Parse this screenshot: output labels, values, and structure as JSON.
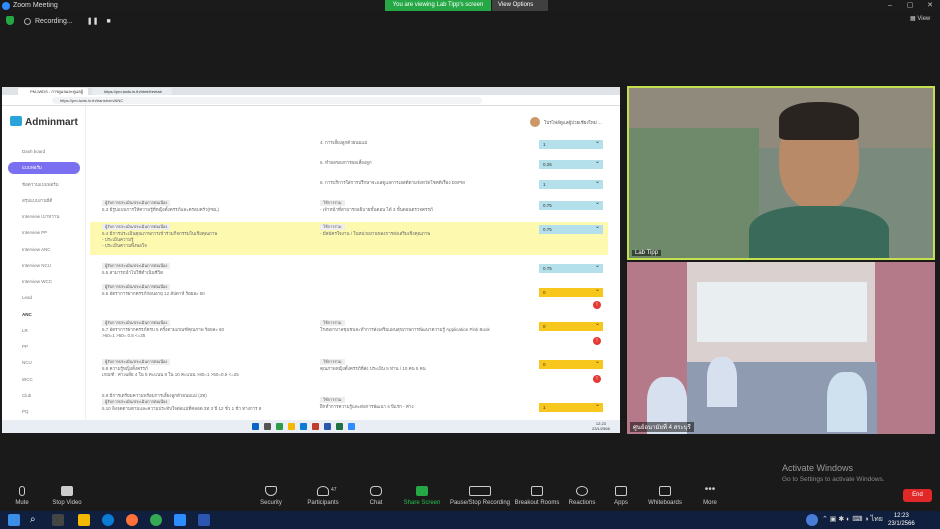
{
  "app": {
    "title": "Zoom Meeting",
    "share_banner": "You are viewing Lab Tipp's screen",
    "view_options": "View Options",
    "recording": "Recording...",
    "view": "View"
  },
  "browser": {
    "tab1": "PM-IWDS - การดูแลและดูแลผู้ป่วย",
    "tab2": "https://pm-iwds.in.th/html/freetab",
    "url": "https://pm-iwds.in.th/transform/ANC"
  },
  "app_page": {
    "logo": "Adminmart",
    "user": "โปรไฟล์ดูแลผู้ป่วยเชียงใหม่ ...",
    "nav": [
      "Dash board",
      "แบบฟอร์ม",
      "ข้อความแบบฟอร์ม",
      "สรุปแบบงานมีดี",
      "Interview เบาหวาน",
      "Interview PP",
      "Interview ANC",
      "Interview NCU",
      "Interview WCC",
      "Lead",
      "ANC",
      "LR",
      "PP",
      "NCU",
      "WCC",
      "Club",
      "PQ"
    ],
    "rows": [
      {
        "q": "4. การเลี้ยงลูกด้วยนมแม่",
        "val": "1"
      },
      {
        "q": "5. ทำผลของการผลเลี้ยงลูก",
        "val": "0.25"
      },
      {
        "q": "6. การบริการใส่การปรึกษาจะแลดูแลการเอสดีตามจังหวัดโชคดีเรื่อง DSPM",
        "val": "1"
      },
      {
        "tag": "ผู้รับการประเมิน/ประเมินการต่อเนื่อง",
        "q": "5.3 มีรูปแบบการให้ความรู้ที่หญิงตั้งครรภ์และครอบครัว(PBL)",
        "tag2": "ใช้การร่วม",
        "note": "- เจ้าหน้าที่สามารถอธิบายขั้นตอน ได้ 3 ขั้นตอนตรวจครรภ์",
        "val": "0.75"
      },
      {
        "tag": "ผู้รับการประเมิน/ประเมินการต่อเนื่อง",
        "q": "5.4 มีการประเมินคุณภาพการเข้าร่วมกิจกรรมในเชิงคุณภาพ",
        "sub1": "- ประเมินความรู้",
        "sub2": "- ประเมินความพึงพอใจ",
        "tag2": "ใช้การร่วม",
        "note": "- มีสมัครใจงาน / ในหน่วยงานของการส่งเสริมเชิงคุณภาพ",
        "val": "0.75"
      },
      {
        "tag": "ผู้รับการประเมิน/ประเมินการต่อเนื่อง",
        "q": "5.5 สามารถนำไปใช้ดำเนินชีวิต",
        "val": "0.75"
      },
      {
        "tag": "ผู้รับการประเมิน/ประเมินการต่อเนื่อง",
        "q": "5.6 อัตราการฝากครรภ์ก่อนอายุ 12 สัปดาห์ ร้อยละ 50",
        "val": "0"
      },
      {
        "tag": "ผู้รับการประเมิน/ประเมินการต่อเนื่อง",
        "q": "5.7 อัตราการฝากครรภ์ครบ 5 ครั้งตามเกณฑ์คุณภาพ ร้อยละ 60",
        "sub1": ">60=1 >50= 0.5 <=25",
        "tag2": "ใช้การร่วม",
        "note": "โรงพยาบาลชุมชนจะทำการส่งเสริมแผนสุขภาพการพัฒนาความรู้ Application Pink Book",
        "val": "0"
      },
      {
        "tag": "ผู้รับการประเมิน/ประเมินการต่อเนื่อง",
        "q": "5.8 ความรู้หญิงตั้งครรภ์",
        "sub1": "เกณฑ์ : ค่าเฉลี่ย 4 ใน 5 คะแนน 8 ใน 10 คะแนน >80=1 >50=0.5 <=25",
        "tag2": "ใช้การร่วม",
        "note": "คุณภาพหญิงตั้งครรภ์ที่ส่ง ประเมิน 5 ท่าน / 10 คน 5 คน",
        "val": "0"
      },
      {
        "q": "5.9 มีการเตรียมความพร้อมการเลี้ยงลูกด้วยนมแม่ (3ท)",
        "tag": "ผู้รับการประเมิน/ประเมินการต่อเนื่อง",
        "q2": "5.10 ลิงจดตามตามและความประทับใจต่อแม่ที่คลอด 3ท 3 ปี 12 ชั่ว 1 ชั่ว ทางการ 8",
        "tag2": "ใช้การร่วม",
        "note": "ฝึกทำการความรู้และต่อการพัฒนา 4 ปีแรก - ค่าง",
        "val": "1"
      }
    ]
  },
  "taskbar_in": {
    "time": "12:23",
    "date": "23/1/2566"
  },
  "videos": {
    "tile1": "Lab Tipp",
    "tile2": "ศูนย์อนามัยที่ 4 สระบุรี"
  },
  "activate": {
    "title": "Activate Windows",
    "sub": "Go to Settings to activate Windows."
  },
  "toolbar": {
    "mute": "Mute",
    "stop_video": "Stop Video",
    "security": "Security",
    "participants": "Participants",
    "participants_count": "47",
    "chat": "Chat",
    "share": "Share Screen",
    "record": "Pause/Stop Recording",
    "breakout": "Breakout Rooms",
    "reactions": "Reactions",
    "apps": "Apps",
    "whiteboards": "Whiteboards",
    "more": "More",
    "end": "End"
  },
  "clock": {
    "time": "12:23",
    "date": "23/1/2566"
  },
  "colors": {
    "share_green": "#26a745",
    "end_red": "#e02828",
    "select_blue": "#b3e0ea",
    "select_yellow": "#f7c71e",
    "nav_purple": "#7a6ff0",
    "highlight": "#fdfab0"
  }
}
